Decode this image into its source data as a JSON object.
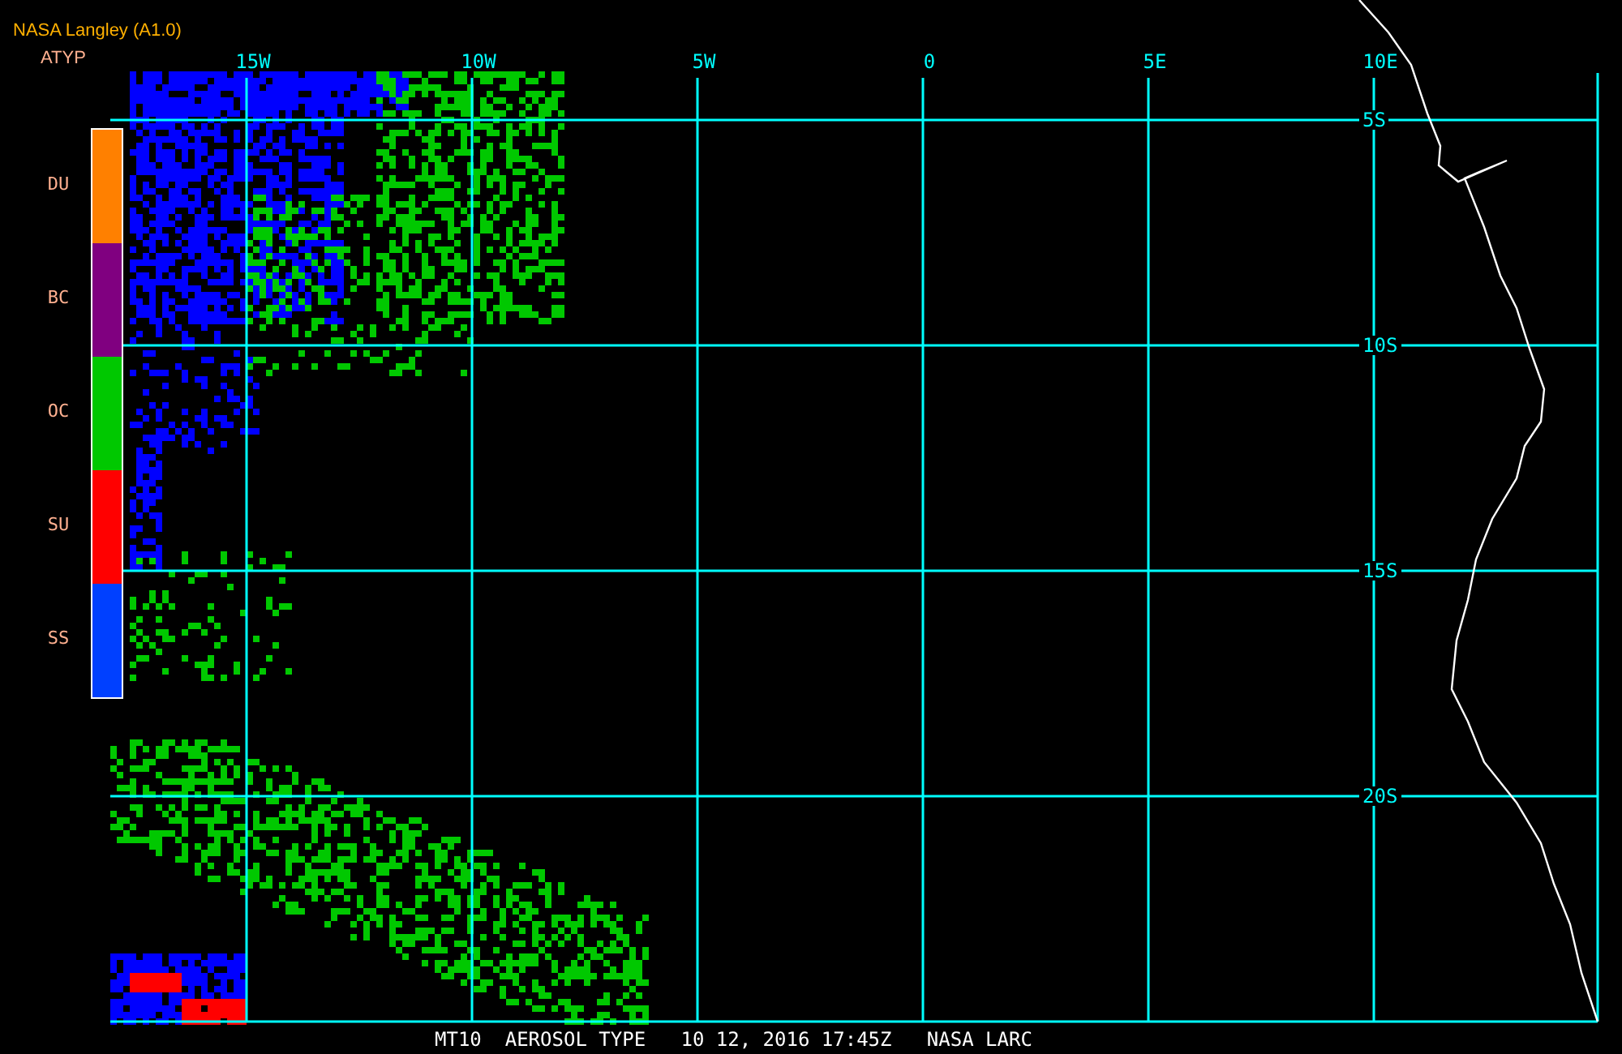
{
  "header": {
    "title": "NASA Langley (A1.0)",
    "product": "ATYP"
  },
  "legend": [
    {
      "label": "DU",
      "color": "#ff8000"
    },
    {
      "label": "BC",
      "color": "#800080"
    },
    {
      "label": "OC",
      "color": "#00c800"
    },
    {
      "label": "SU",
      "color": "#ff0000"
    },
    {
      "label": "SS",
      "color": "#0040ff"
    }
  ],
  "map": {
    "longitude_labels": [
      "15W",
      "10W",
      "5W",
      "0",
      "5E",
      "10E"
    ],
    "latitude_labels": [
      "5S",
      "10S",
      "15S",
      "20S"
    ]
  },
  "footer": {
    "caption": "MT10  AEROSOL TYPE   10 12, 2016 17:45Z   NASA LARC"
  }
}
